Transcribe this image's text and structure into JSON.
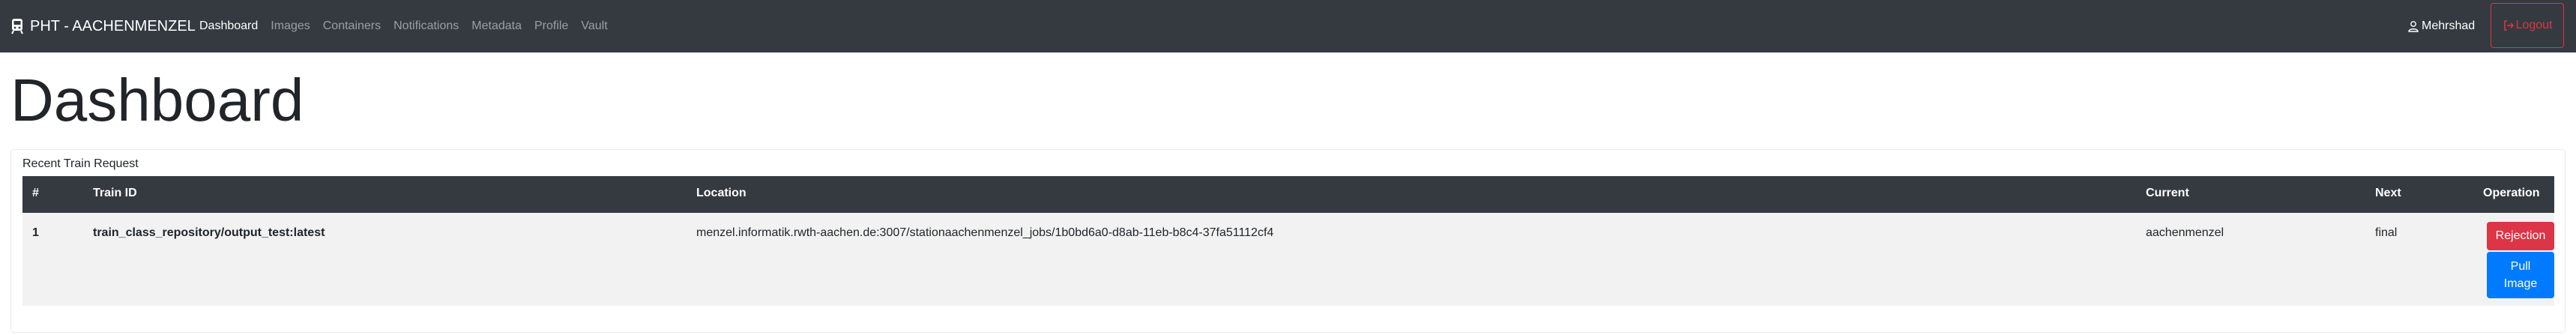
{
  "navbar": {
    "brand": "PHT - AACHENMENZEL",
    "brand_icon": "train-icon",
    "links": [
      {
        "label": "Dashboard",
        "active": true
      },
      {
        "label": "Images",
        "active": false
      },
      {
        "label": "Containers",
        "active": false
      },
      {
        "label": "Notifications",
        "active": false
      },
      {
        "label": "Metadata",
        "active": false
      },
      {
        "label": "Profile",
        "active": false
      },
      {
        "label": "Vault",
        "active": false
      }
    ],
    "user": {
      "label": "Mehrshad",
      "icon": "user-icon"
    },
    "logout": {
      "label": "Logout",
      "icon": "sign-out-icon"
    }
  },
  "page": {
    "title": "Dashboard"
  },
  "recent_requests": {
    "title": "Recent Train Request",
    "columns": [
      "#",
      "Train ID",
      "Location",
      "Current",
      "Next",
      "Operation"
    ],
    "rows": [
      {
        "num": "1",
        "train_id": "train_class_repository/output_test:latest",
        "location": "menzel.informatik.rwth-aachen.de:3007/stationaachenmenzel_jobs/1b0bd6a0-d8ab-11eb-b8c4-37fa51112cf4",
        "current": "aachenmenzel",
        "next": "final",
        "actions": {
          "reject": "Rejection",
          "pull": "Pull Image"
        }
      }
    ]
  },
  "colors": {
    "navbar_bg": "#343a40",
    "danger": "#dc3545",
    "primary": "#007bff",
    "row_bg": "#f2f2f2"
  }
}
